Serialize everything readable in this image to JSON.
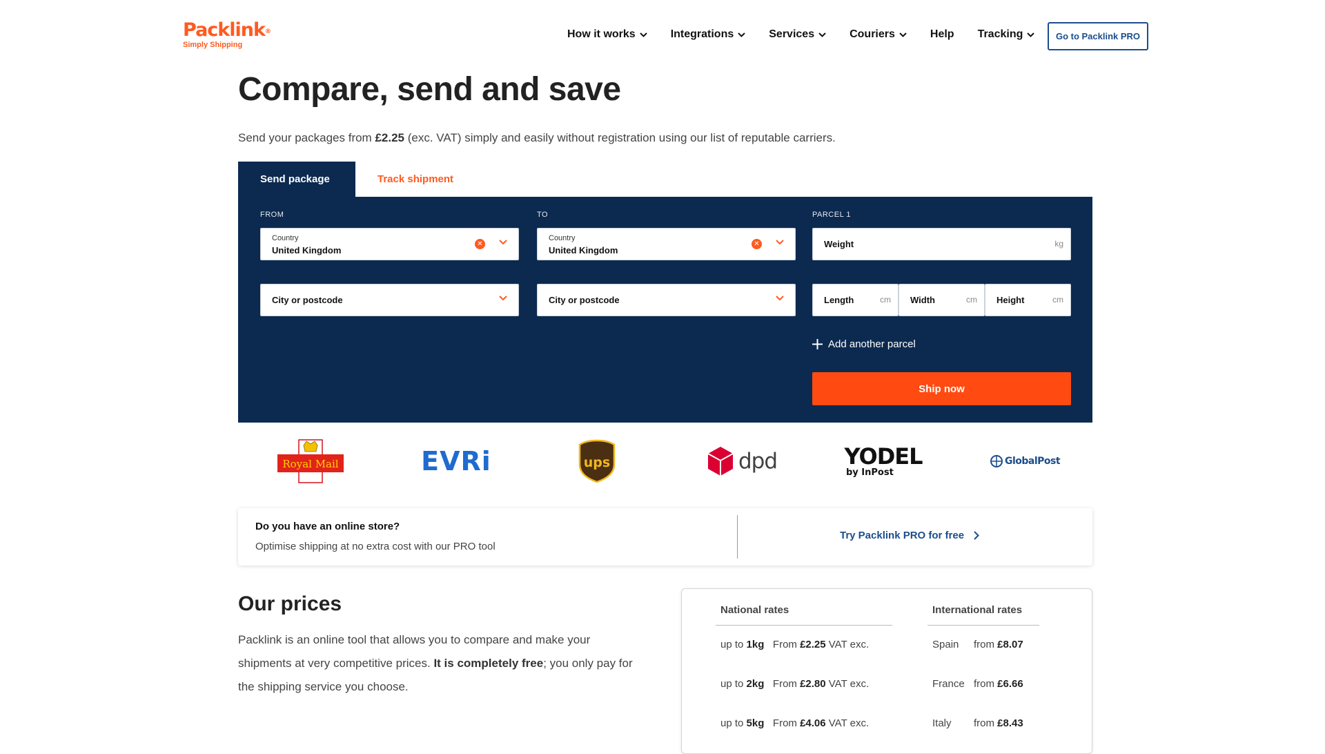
{
  "header": {
    "logo_text": "Packlink",
    "logo_reg": "®",
    "logo_tagline": "Simply Shipping",
    "nav": [
      {
        "label": "How it works",
        "has_dropdown": true
      },
      {
        "label": "Integrations",
        "has_dropdown": true
      },
      {
        "label": "Services",
        "has_dropdown": true
      },
      {
        "label": "Couriers",
        "has_dropdown": true
      },
      {
        "label": "Help",
        "has_dropdown": false
      },
      {
        "label": "Tracking",
        "has_dropdown": true
      }
    ],
    "pro_button": "Go to Packlink PRO"
  },
  "hero": {
    "title": "Compare, send and save",
    "subtitle_prefix": "Send your packages from ",
    "subtitle_price": "£2.25",
    "subtitle_suffix": " (exc. VAT) simply and easily without registration using our list of reputable carriers."
  },
  "tabs": [
    {
      "label": "Send package",
      "active": true
    },
    {
      "label": "Track shipment",
      "active": false
    }
  ],
  "form": {
    "from_label": "FROM",
    "to_label": "TO",
    "parcel_label": "PARCEL 1",
    "from_country_label": "Country",
    "from_country_value": "United Kingdom",
    "to_country_label": "Country",
    "to_country_value": "United Kingdom",
    "from_city_placeholder": "City or postcode",
    "to_city_placeholder": "City or postcode",
    "weight_label": "Weight",
    "weight_unit": "kg",
    "length_label": "Length",
    "width_label": "Width",
    "height_label": "Height",
    "dim_unit": "cm",
    "add_parcel": "Add another parcel",
    "ship_now": "Ship now"
  },
  "couriers": [
    {
      "name": "Royal Mail",
      "icon": "royal-mail-logo"
    },
    {
      "name": "EVRi",
      "icon": "evri-logo"
    },
    {
      "name": "ups",
      "icon": "ups-logo"
    },
    {
      "name": "dpd",
      "icon": "dpd-logo"
    },
    {
      "name": "YODEL",
      "sub": "by InPost",
      "icon": "yodel-logo"
    },
    {
      "name": "GlobalPost",
      "icon": "globalpost-logo"
    }
  ],
  "store": {
    "question": "Do you have an online store?",
    "description": "Optimise shipping at no extra cost with our PRO tool",
    "link": "Try Packlink PRO for free"
  },
  "prices": {
    "title": "Our prices",
    "para_1": "Packlink is an online tool that allows you to compare and make your shipments at very competitive prices. ",
    "para_bold": "It is completely free",
    "para_2": "; you only pay for the shipping service you choose.",
    "national_header": "National rates",
    "international_header": "International rates",
    "national": [
      {
        "prefix": "up to ",
        "weight": "1kg",
        "from": "From ",
        "price": "£2.25",
        "suffix": " VAT exc."
      },
      {
        "prefix": "up to ",
        "weight": "2kg",
        "from": "From ",
        "price": "£2.80",
        "suffix": " VAT exc."
      },
      {
        "prefix": "up to ",
        "weight": "5kg",
        "from": "From ",
        "price": "£4.06",
        "suffix": " VAT exc."
      }
    ],
    "international": [
      {
        "country": "Spain",
        "from": "from ",
        "price": "£8.07"
      },
      {
        "country": "France",
        "from": "from ",
        "price": "£6.66"
      },
      {
        "country": "Italy",
        "from": "from ",
        "price": "£8.43"
      }
    ]
  },
  "colors": {
    "brand_orange": "#ff5a1f",
    "navy": "#0c2a50",
    "pro_blue": "#1b4d8c"
  }
}
